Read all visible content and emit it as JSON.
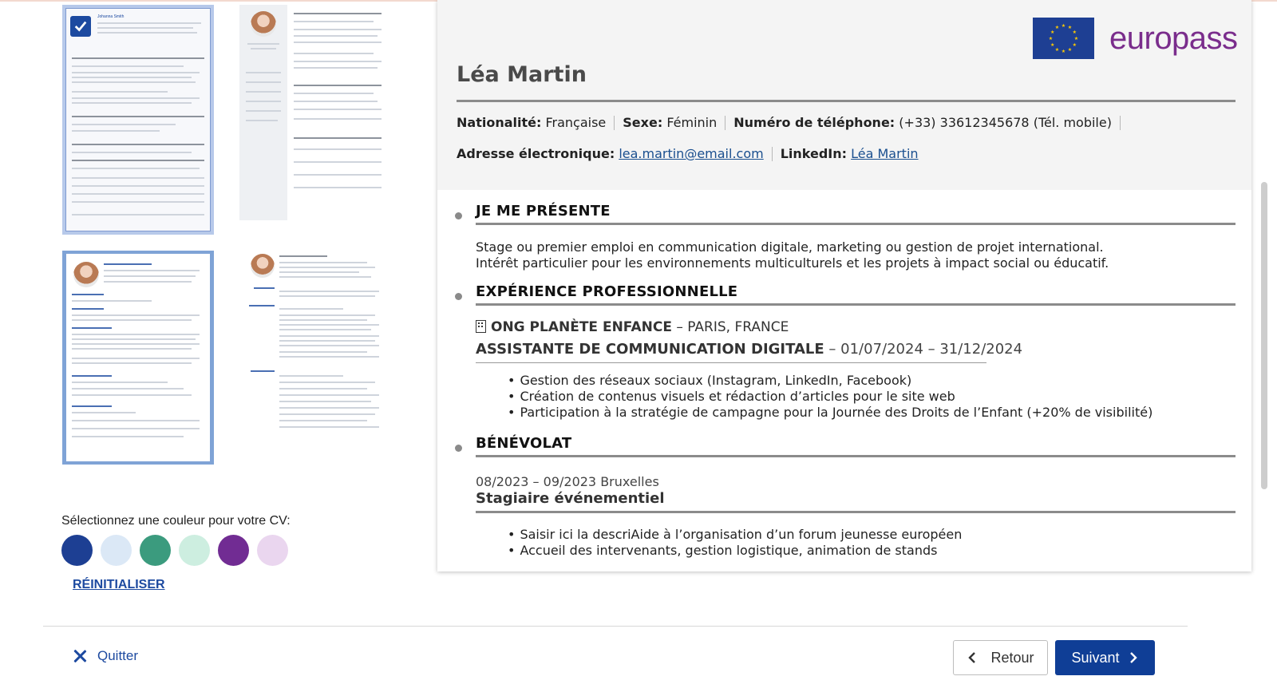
{
  "templates": {
    "selected_index": 0,
    "thumb_name": "Johanna Smith"
  },
  "color_picker": {
    "label": "Sélectionnez une couleur pour votre CV:",
    "colors": [
      "#1d3f93",
      "#dbe8f6",
      "#3b9b7e",
      "#cdeee0",
      "#712c93",
      "#ead6ef"
    ],
    "reset_label": "RÉINITIALISER"
  },
  "cv": {
    "brand": "europass",
    "brand_color": "#7a2d8c",
    "name": "Léa Martin",
    "info_row1": [
      {
        "label": "Nationalité:",
        "value": "Française"
      },
      {
        "label": "Sexe:",
        "value": "Féminin"
      },
      {
        "label": "Numéro de téléphone:",
        "value": "(+33) 33612345678 (Tél. mobile)"
      }
    ],
    "email_label": "Adresse électronique:",
    "email_value": "lea.martin@email.com",
    "linkedin_label": "LinkedIn:",
    "linkedin_value": "Léa Martin",
    "about": {
      "title": "JE ME PRÉSENTE",
      "lines": [
        "Stage ou premier emploi en communication digitale, marketing ou gestion de projet international.",
        "Intérêt particulier pour les environnements multiculturels et les projets à impact social ou éducatif."
      ]
    },
    "experience": {
      "title": "EXPÉRIENCE PROFESSIONNELLE",
      "org": "ONG PLANÈTE ENFANCE",
      "location": "– PARIS, FRANCE",
      "job_title": "ASSISTANTE DE COMMUNICATION DIGITALE",
      "dates": "– 01/07/2024 – 31/12/2024",
      "bullets": [
        "Gestion des réseaux sociaux (Instagram, LinkedIn, Facebook)",
        "Création de contenus visuels et rédaction d’articles pour le site web",
        "Participation à la stratégie de campagne pour la Journée des Droits de l’Enfant (+20% de visibilité)"
      ]
    },
    "volunteer": {
      "title": "BÉNÉVOLAT",
      "dates": "08/2023 – 09/2023 Bruxelles",
      "role": "Stagiaire événementiel",
      "bullets": [
        "Saisir ici la descriAide à l’organisation d’un forum jeunesse européen",
        "Accueil des intervenants, gestion logistique, animation de stands"
      ]
    }
  },
  "footer": {
    "quit_label": "Quitter",
    "back_label": "Retour",
    "next_label": "Suivant"
  }
}
